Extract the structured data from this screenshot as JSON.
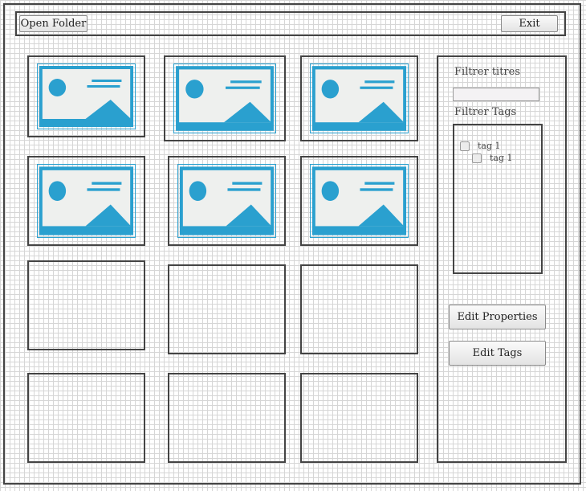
{
  "toolbar": {
    "open_folder_label": "Open Folder",
    "exit_label": "Exit"
  },
  "gallery": {
    "tiles": [
      {
        "has_image": true,
        "icon": "image-placeholder-icon"
      },
      {
        "has_image": true,
        "icon": "image-placeholder-icon"
      },
      {
        "has_image": true,
        "icon": "image-placeholder-icon"
      },
      {
        "has_image": true,
        "icon": "image-placeholder-icon"
      },
      {
        "has_image": true,
        "icon": "image-placeholder-icon"
      },
      {
        "has_image": true,
        "icon": "image-placeholder-icon"
      },
      {
        "has_image": false
      },
      {
        "has_image": false
      },
      {
        "has_image": false
      },
      {
        "has_image": false
      },
      {
        "has_image": false
      },
      {
        "has_image": false
      }
    ]
  },
  "sidebar": {
    "filter_titles_label": "Filtrer titres",
    "filter_titles_value": "",
    "filter_tags_label": "Filtrer Tags",
    "tags": [
      {
        "label": "tag 1",
        "checked": false
      },
      {
        "label": "tag 1",
        "checked": false
      }
    ],
    "edit_properties_label": "Edit Properties",
    "edit_tags_label": "Edit Tags"
  },
  "colors": {
    "image_accent": "#2aa0cf",
    "image_background": "#eef0ee",
    "border": "#444444"
  }
}
